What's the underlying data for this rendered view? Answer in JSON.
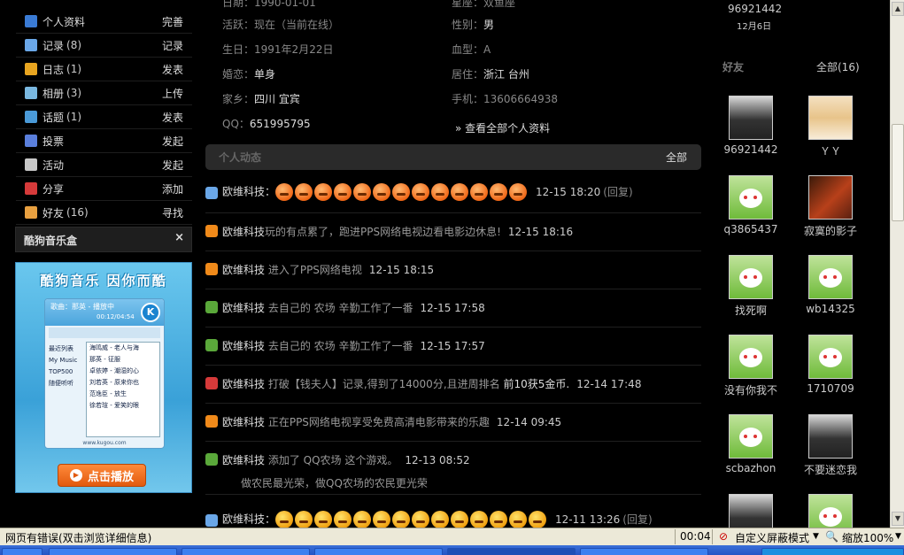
{
  "sidebar": {
    "items": [
      {
        "label": "个人资料",
        "count": "",
        "action": "完善",
        "icon": "profile-icon",
        "color": "#3a7bd5"
      },
      {
        "label": "记录",
        "count": "(8)",
        "action": "记录",
        "icon": "speech-bubble-icon",
        "color": "#6aa7e8"
      },
      {
        "label": "日志",
        "count": "(1)",
        "action": "发表",
        "icon": "notebook-icon",
        "color": "#e8a520"
      },
      {
        "label": "相册",
        "count": "(3)",
        "action": "上传",
        "icon": "photo-icon",
        "color": "#7ab8e0"
      },
      {
        "label": "话题",
        "count": "(1)",
        "action": "发表",
        "icon": "topic-icon",
        "color": "#4a9ad8"
      },
      {
        "label": "投票",
        "count": "",
        "action": "发起",
        "icon": "chart-icon",
        "color": "#5a7fdc"
      },
      {
        "label": "活动",
        "count": "",
        "action": "发起",
        "icon": "calendar-icon",
        "color": "#c8c8c8"
      },
      {
        "label": "分享",
        "count": "",
        "action": "添加",
        "icon": "heart-icon",
        "color": "#d63a3a"
      },
      {
        "label": "好友",
        "count": "(16)",
        "action": "寻找",
        "icon": "handshake-icon",
        "color": "#e8a040"
      }
    ],
    "music_box": {
      "title": "酷狗音乐盒",
      "close": "×",
      "ad_title": "酷狗音乐 因你而酷",
      "now_playing": "歌曲：那英 - 播放中",
      "time": "00:12/04:54",
      "categories": [
        "最近列表",
        "My Music",
        "TOP500",
        "随便听听"
      ],
      "songs": [
        "海鸣威 - 老人与海",
        "那英 - 征服",
        "卓依婷 - 潮湿的心",
        "刘若英 - 原来你也",
        "范逸臣 - 放生",
        "徐若瑄 - 爱笑的眼"
      ],
      "footer": "www.kugou.com",
      "play_label": "点击播放"
    }
  },
  "profile": {
    "activity_label": "活跃：",
    "activity_value": "现在（当前在线）",
    "birthday_label": "生日：",
    "birthday_value": "1991年2月22日",
    "marital_label": "婚恋：",
    "marital_value": "单身",
    "hometown_label": "家乡：",
    "hometown_value": "四川 宜宾",
    "qq_label": "QQ：",
    "qq_value": "651995795",
    "gender_label": "性别：",
    "gender_value": "男",
    "blood_label": "血型：",
    "blood_value": "A",
    "residence_label": "居住：",
    "residence_value": "浙江 台州",
    "phone_label": "手机：",
    "phone_value": "13606664938",
    "view_all": "» 查看全部个人资料"
  },
  "feed": {
    "title": "个人动态",
    "all_label": "全部",
    "items": [
      {
        "icon": "speech-bubble-icon",
        "color": "#6aa7e8",
        "name": "欧维科技：",
        "text": "",
        "highlight": "",
        "time": "12-15 18:20",
        "reply": "(回复)",
        "emoji_count": 13,
        "angry": true,
        "sub": ""
      },
      {
        "icon": "smiley-icon",
        "color": "#f08a1a",
        "name": "欧维科技",
        "text": "玩的有点累了，跑进PPS网络电视边看电影边休息!",
        "highlight": "",
        "time": "12-15 18:16",
        "reply": "",
        "emoji_count": 0,
        "angry": false,
        "sub": ""
      },
      {
        "icon": "smiley-icon",
        "color": "#f08a1a",
        "name": "欧维科技",
        "text": " 进入了PPS网络电视",
        "highlight": "",
        "time": "12-15 18:15",
        "reply": "",
        "emoji_count": 0,
        "angry": false,
        "sub": ""
      },
      {
        "icon": "plant-icon",
        "color": "#5aa83a",
        "name": "欧维科技",
        "text": " 去自己的 农场 辛勤工作了一番",
        "highlight": "",
        "time": "12-15 17:58",
        "reply": "",
        "emoji_count": 0,
        "angry": false,
        "sub": ""
      },
      {
        "icon": "plant-icon",
        "color": "#5aa83a",
        "name": "欧维科技",
        "text": " 去自己的 农场 辛勤工作了一番",
        "highlight": "",
        "time": "12-15 17:57",
        "reply": "",
        "emoji_count": 0,
        "angry": false,
        "sub": ""
      },
      {
        "icon": "game-icon",
        "color": "#d63a3a",
        "name": "欧维科技",
        "text": " 打破【钱夫人】记录,得到了14000分,且进周排名 ",
        "highlight": "前10获5金币.",
        "time": "12-14 17:48",
        "reply": "",
        "emoji_count": 0,
        "angry": false,
        "sub": ""
      },
      {
        "icon": "smiley-icon",
        "color": "#f08a1a",
        "name": "欧维科技",
        "text": " 正在PPS网络电视享受免费高清电影带来的乐趣",
        "highlight": "",
        "time": "12-14 09:45",
        "reply": "",
        "emoji_count": 0,
        "angry": false,
        "sub": ""
      },
      {
        "icon": "plant-icon",
        "color": "#5aa83a",
        "name": "欧维科技",
        "text": " 添加了 QQ农场 这个游戏。",
        "highlight": "",
        "time": "12-13 08:52",
        "reply": "",
        "emoji_count": 0,
        "angry": false,
        "sub": "做农民最光荣，做QQ农场的农民更光荣"
      },
      {
        "icon": "speech-bubble-icon",
        "color": "#6aa7e8",
        "name": "欧维科技：",
        "text": "",
        "highlight": "",
        "time": "12-11 13:26",
        "reply": "(回复)",
        "emoji_count": 14,
        "angry": false,
        "sub": ""
      }
    ]
  },
  "friends": {
    "top_name": "96921442",
    "top_date": "12月6日",
    "title": "好友",
    "all_label": "全部(16)",
    "list": [
      {
        "name": "96921442",
        "kind": "photo-dark"
      },
      {
        "name": "ＹＹ",
        "kind": "cartoon"
      },
      {
        "name": "q3865437",
        "kind": "rabbit"
      },
      {
        "name": "寂寞的影子",
        "kind": "photo-red"
      },
      {
        "name": "找死啊",
        "kind": "rabbit"
      },
      {
        "name": "wb14325",
        "kind": "rabbit"
      },
      {
        "name": "没有你我不",
        "kind": "rabbit"
      },
      {
        "name": "1710709",
        "kind": "rabbit"
      },
      {
        "name": "scbazhon",
        "kind": "rabbit"
      },
      {
        "name": "不要迷恋我",
        "kind": "photo-dark"
      },
      {
        "name": "",
        "kind": "photo-dark"
      },
      {
        "name": "",
        "kind": "rabbit"
      }
    ]
  },
  "statusbar": {
    "error": "网页有错误(双击浏览详细信息)",
    "time": "00:04",
    "block_mode": "自定义屏蔽模式",
    "zoom": "缩放100%"
  }
}
